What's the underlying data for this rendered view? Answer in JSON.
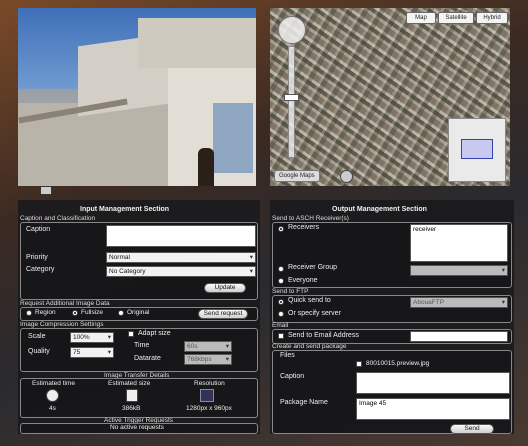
{
  "map": {
    "buttons": [
      "Map",
      "Satellite",
      "Hybrid"
    ],
    "google_label": "Google Maps"
  },
  "input": {
    "title": "Input Management Section",
    "caption_section": "Caption and Classification",
    "caption_label": "Caption",
    "caption_value": "",
    "priority_label": "Priority",
    "priority_value": "Normal",
    "category_label": "Category",
    "category_value": "No Category",
    "update_button": "Update",
    "request_section": "Request Additional Image Data",
    "region_label": "Region",
    "fullsize_label": "Fullsize",
    "original_label": "Original",
    "send_request_button": "Send request",
    "compression_section": "Image Compression Settings",
    "scale_label": "Scale",
    "scale_value": "100%",
    "quality_label": "Quality",
    "quality_value": "75",
    "adapt_label": "Adapt size",
    "time_label": "Time",
    "time_value": "60s",
    "datarate_label": "Datarate",
    "datarate_value": "768kbps",
    "transfer_section": "Image Transfer Details",
    "est_time_label": "Estimated time",
    "est_time_value": "4s",
    "est_size_label": "Estimated size",
    "est_size_value": "386kB",
    "resolution_label": "Resolution",
    "resolution_value": "1280px x 960px",
    "active_section": "Active Trigger Requests",
    "active_value": "No active requests"
  },
  "output": {
    "title": "Output Management Section",
    "asch_section": "Send to ASCH Receiver(s)",
    "receivers_label": "Receivers",
    "receivers_value": "receiver",
    "group_label": "Receiver Group",
    "group_value": "",
    "everyone_label": "Everyone",
    "ftp_section": "Send to FTP",
    "quick_label": "Quick send to",
    "quick_value": "AbouaFTP",
    "specify_label": "Or specify server",
    "email_section": "Email",
    "email_label": "Send to Email Address",
    "email_value": "",
    "package_section": "Create and send package",
    "files_label": "Files",
    "file_name": "80010015.preview.jpg",
    "caption_label": "Caption",
    "caption_value": "",
    "package_label": "Package Name",
    "package_value": "Image 45",
    "send_button": "Send"
  }
}
